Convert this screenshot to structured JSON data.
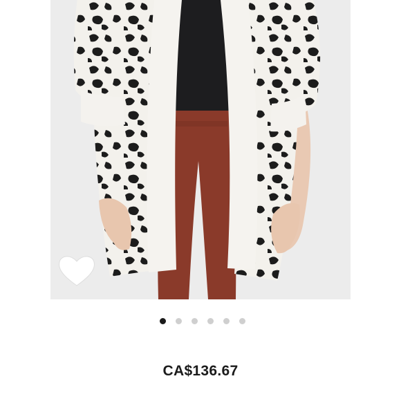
{
  "product": {
    "image_alt": "",
    "price": "CA$136.67"
  },
  "carousel": {
    "total": 6,
    "active_index": 0
  },
  "icons": {
    "wishlist": "heart-outline-icon"
  },
  "colors": {
    "active_dot": "#1a1a1a",
    "inactive_dot": "#cfcfcf",
    "price_text": "#1b1b1b",
    "heart": "#ffffff"
  }
}
